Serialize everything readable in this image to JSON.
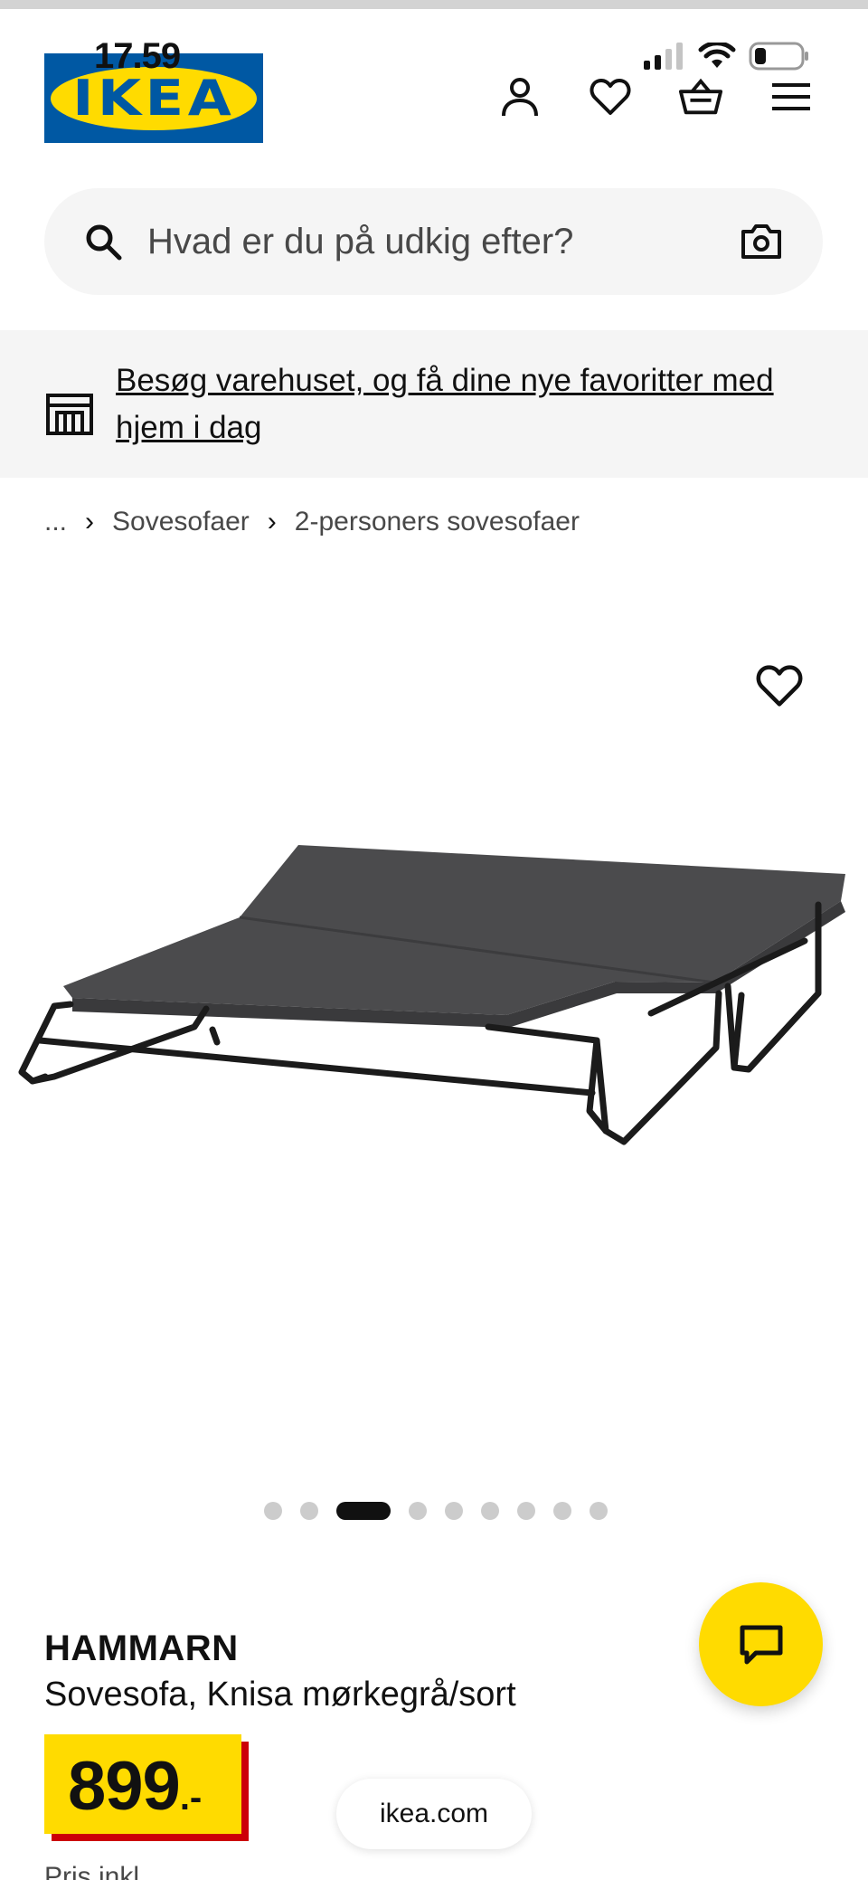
{
  "status_bar": {
    "time": "17.59"
  },
  "logo": {
    "text": "IKEA",
    "registered": "®"
  },
  "header": {
    "icons": [
      "account-icon",
      "heart-icon",
      "basket-icon",
      "menu-icon"
    ]
  },
  "search": {
    "placeholder": "Hvad er du på udkig efter?"
  },
  "banner": {
    "text": "Besøg varehuset, og få dine nye favoritter med hjem i dag"
  },
  "breadcrumb": {
    "items": [
      "...",
      "Sovesofaer",
      "2-personers sovesofaer"
    ]
  },
  "gallery": {
    "total_images": 9,
    "active_index": 2
  },
  "product": {
    "name": "HAMMARN",
    "description": "Sovesofa, Knisa mørkegrå/sort",
    "price": "899",
    "price_suffix": ".-"
  },
  "browser": {
    "url": "ikea.com"
  },
  "footer_cut": "Pris inkl"
}
